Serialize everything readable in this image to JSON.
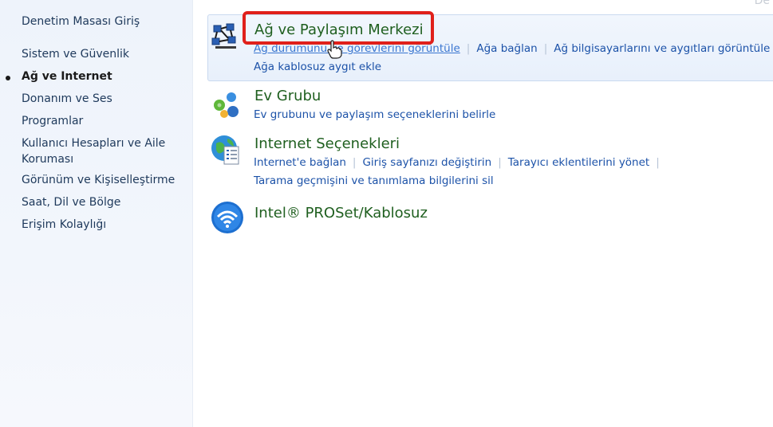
{
  "sidebar": {
    "items": [
      {
        "label": "Denetim Masası Giriş"
      },
      {
        "label": "Sistem ve Güvenlik"
      },
      {
        "label": "Ağ ve Internet"
      },
      {
        "label": "Donanım ve Ses"
      },
      {
        "label": "Programlar"
      },
      {
        "label": "Kullanıcı Hesapları ve Aile Koruması"
      },
      {
        "label": "Görünüm ve Kişiselleştirme"
      },
      {
        "label": "Saat, Dil ve Bölge"
      },
      {
        "label": "Erişim Kolaylığı"
      }
    ],
    "active_index": 2
  },
  "top_right_text": "De",
  "categories": [
    {
      "title": "Ağ ve Paylaşım Merkezi",
      "icon": "network-icon",
      "links": [
        "Ağ durumunu ve görevlerini görüntüle",
        "Ağa bağlan",
        "Ağ bilgisayarlarını ve aygıtları görüntüle",
        "Ağa kablosuz aygıt ekle"
      ]
    },
    {
      "title": "Ev Grubu",
      "icon": "homegroup-icon",
      "links": [
        "Ev grubunu ve paylaşım seçeneklerini belirle"
      ]
    },
    {
      "title": "Internet Seçenekleri",
      "icon": "internet-options-icon",
      "links": [
        "Internet'e bağlan",
        "Giriş sayfanızı değiştirin",
        "Tarayıcı eklentilerini yönet",
        "Tarama geçmişini ve tanımlama bilgilerini sil"
      ]
    },
    {
      "title": "Intel® PROSet/Kablosuz",
      "icon": "wireless-icon",
      "links": []
    }
  ],
  "colors": {
    "title_green": "#1f5f1f",
    "link_blue": "#1c52a8",
    "highlight_red": "#e0201a"
  }
}
